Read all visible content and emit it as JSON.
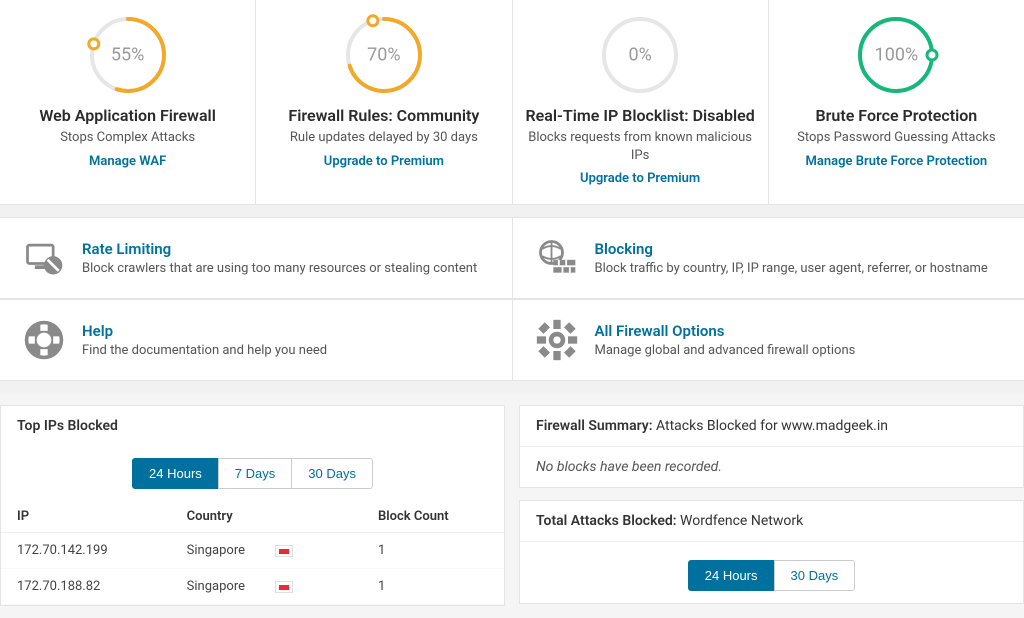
{
  "stats": [
    {
      "pct": 55,
      "title": "Web Application Firewall",
      "desc": "Stops Complex Attacks",
      "link": "Manage WAF",
      "color": "#f0a928"
    },
    {
      "pct": 70,
      "title": "Firewall Rules: Community",
      "desc": "Rule updates delayed by 30 days",
      "link": "Upgrade to Premium",
      "color": "#f0a928"
    },
    {
      "pct": 0,
      "title": "Real-Time IP Blocklist: Disabled",
      "desc": "Blocks requests from known malicious IPs",
      "link": "Upgrade to Premium",
      "color": "#d0d0d0"
    },
    {
      "pct": 100,
      "title": "Brute Force Protection",
      "desc": "Stops Password Guessing Attacks",
      "link": "Manage Brute Force Protection",
      "color": "#16b77b"
    }
  ],
  "options1": [
    {
      "title": "Rate Limiting",
      "desc": "Block crawlers that are using too many resources or stealing content"
    },
    {
      "title": "Blocking",
      "desc": "Block traffic by country, IP, IP range, user agent, referrer, or hostname"
    }
  ],
  "options2": [
    {
      "title": "Help",
      "desc": "Find the documentation and help you need"
    },
    {
      "title": "All Firewall Options",
      "desc": "Manage global and advanced firewall options"
    }
  ],
  "topIps": {
    "title": "Top IPs Blocked",
    "tabs": [
      "24 Hours",
      "7 Days",
      "30 Days"
    ],
    "activeTab": "24 Hours",
    "headers": {
      "ip": "IP",
      "country": "Country",
      "count": "Block Count"
    },
    "rows": [
      {
        "ip": "172.70.142.199",
        "country": "Singapore",
        "count": 1
      },
      {
        "ip": "172.70.188.82",
        "country": "Singapore",
        "count": 1
      }
    ]
  },
  "summary": {
    "label": "Firewall Summary:",
    "text": "Attacks Blocked for www.madgeek.in",
    "empty": "No blocks have been recorded."
  },
  "total": {
    "label": "Total Attacks Blocked:",
    "text": "Wordfence Network",
    "tabs": [
      "24 Hours",
      "30 Days"
    ],
    "activeTab": "24 Hours"
  }
}
